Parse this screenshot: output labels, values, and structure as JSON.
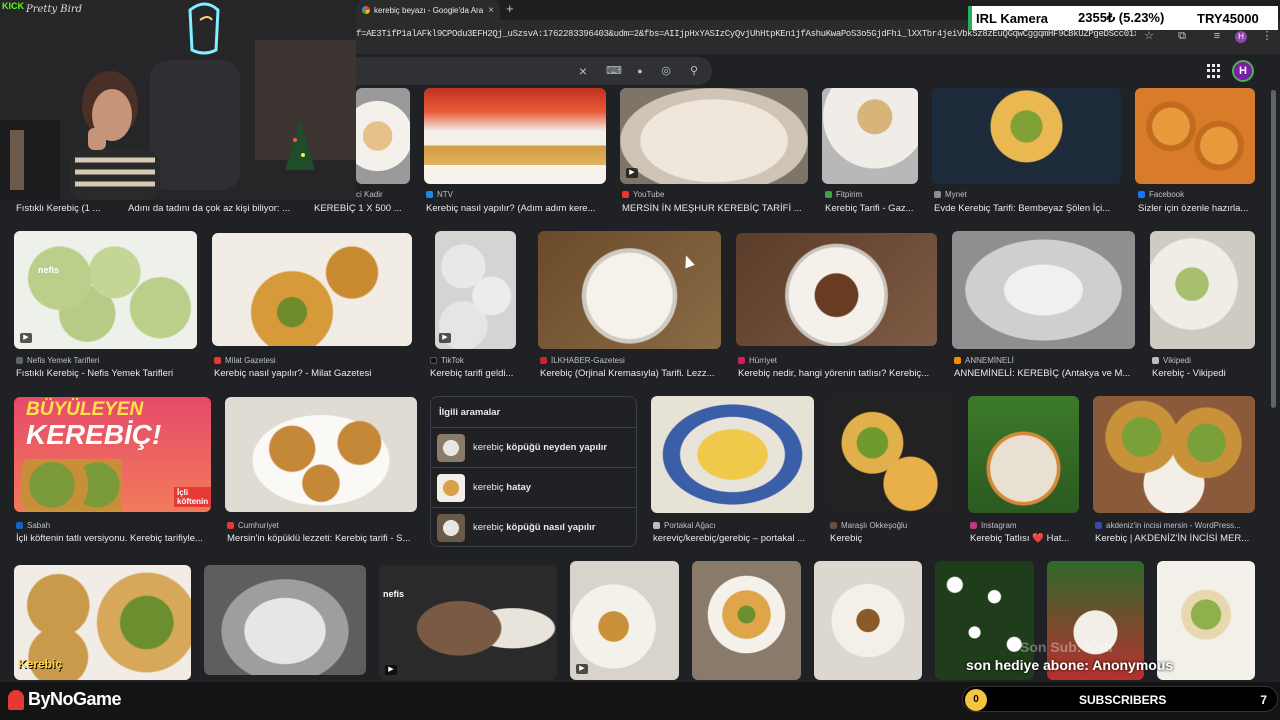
{
  "browser": {
    "tab_title": "kerebiç beyazı - Google'da Ara",
    "tab_close": "×",
    "new_tab": "+",
    "url": "f=AE3TifP1alAFkl9CPOdu3EFH2Qj_uSzsvA:1762283396403&udm=2&fbs=AIIjpHxYASIzCyQvjUhHtpKEn1jfAshuKwaPoS3o5GjdFhi_lXXTbr4jeiVbkSz8zEuQGqwCggqmHF9CBkUZPgeDScc01x..."
  },
  "search": {
    "clear_icon": "×",
    "keyboard_icon": "⌨",
    "mic_icon": "🎤",
    "lens_icon": "◎",
    "search_icon": "⚲",
    "avatar": "H"
  },
  "row1": [
    {
      "src": "ci Kadir",
      "cap": "KEREBİÇ 1 X 500 ...",
      "fav": "#888"
    },
    {
      "src": "NTV",
      "cap": "Kerebiç nasıl yapılır? (Adım adım kere...",
      "fav": "#1e88e5"
    },
    {
      "src": "YouTube",
      "cap": "MERSİN İN MEŞHUR KEREBİÇ TARİFİ ...",
      "fav": "#e53935"
    },
    {
      "src": "Fitpirim",
      "cap": "Kerebiç Tarifi - Gaz...",
      "fav": "#43a047"
    },
    {
      "src": "Mynet",
      "cap": "Evde Kerebiç Tarifi: Bembeyaz Şölen İçi...",
      "fav": "#8e8e8e"
    },
    {
      "src": "Facebook",
      "cap": "Sizler için özenle hazırla...",
      "fav": "#1877f2"
    }
  ],
  "row1_left": [
    {
      "cap": "Fıstıklı Kerebiç (1 ..."
    },
    {
      "cap": "Adını da tadını da çok az kişi biliyor: ..."
    }
  ],
  "row2": [
    {
      "src": "Nefis Yemek Tarifleri",
      "cap": "Fıstıklı Kerebiç - Nefis Yemek Tarifleri",
      "fav": "#5f6368"
    },
    {
      "src": "Milat Gazetesi",
      "cap": "Kerebiç nasıl yapılır? - Milat Gazetesi",
      "fav": "#e53935"
    },
    {
      "src": "TikTok",
      "cap": "Kerebiç tarifi geldi...",
      "fav": "#222"
    },
    {
      "src": "İLKHABER-Gazetesi",
      "cap": "Kerebiç (Orjinal Kremasıyla) Tarifi. Lezz...",
      "fav": "#c62828"
    },
    {
      "src": "Hürriyet",
      "cap": "Kerebiç nedir, hangi yörenin tatlısı? Kerebiç...",
      "fav": "#d81b60"
    },
    {
      "src": "ANNEMİNELİ",
      "cap": "ANNEMİNELİ: KEREBİÇ (Antakya ve M...",
      "fav": "#fb8c00"
    },
    {
      "src": "Vikipedi",
      "cap": "Kerebiç - Vikipedi",
      "fav": "#bdbdbd"
    }
  ],
  "row3": [
    {
      "src": "Sabah",
      "cap": "İçli köftenin tatlı versiyonu. Kerebiç tarifiyle...",
      "fav": "#1565c0"
    },
    {
      "src": "Cumhuriyet",
      "cap": "Mersin'in köpüklü lezzeti: Kerebiç tarifi - S...",
      "fav": "#e53935"
    },
    {
      "src": "Portakal Ağacı",
      "cap": "kereviç/kerebiç/gerebiç – portakal ...",
      "fav": "#bdbdbd"
    },
    {
      "src": "Maraşlı Okkeşoğlu",
      "cap": "Kerebiç",
      "fav": "#6d4c41"
    },
    {
      "src": "Instagram",
      "cap": "Kerebiç Tatlısı ❤️ Hat...",
      "fav": "#c13584"
    },
    {
      "src": "akdeniz'in incisi mersin - WordPress...",
      "cap": "Kerebiç | AKDENİZ'İN İNCİSİ MER...",
      "fav": "#3949ab"
    }
  ],
  "banner_text": {
    "line1": "BÜYÜLEYEN",
    "line2": "KEREBİÇ!",
    "tag1": "İçli",
    "tag2": "köftenin"
  },
  "kerebic_label": "Kerebiç",
  "nefis_label": "nefis",
  "related": {
    "title": "İlgili aramalar",
    "items": [
      {
        "pre": "kerebiç ",
        "bold": "köpüğü neyden yapılır"
      },
      {
        "pre": "kerebiç ",
        "bold": "hatay"
      },
      {
        "pre": "kerebiç ",
        "bold": "köpüğü nasıl yapılır"
      }
    ]
  },
  "overlay": {
    "kick": "KICK",
    "signature": "Pretty Bird",
    "ticker_name": "IRL Kamera",
    "ticker_value": "2355₺ (5.23%)",
    "ticker_symbol": "TRY45000",
    "brand": "ByNoGame",
    "sub_count": "0",
    "sub_label": "SUBSCRIBERS",
    "sub_goal": "7",
    "last_sub": "son hediye abone: Anonymous",
    "ghost_text": "Son Sub: Koti"
  },
  "colors": {
    "accent": "#53fc18",
    "ticker_green": "#27ae60",
    "sub_yellow": "#f5c542"
  }
}
